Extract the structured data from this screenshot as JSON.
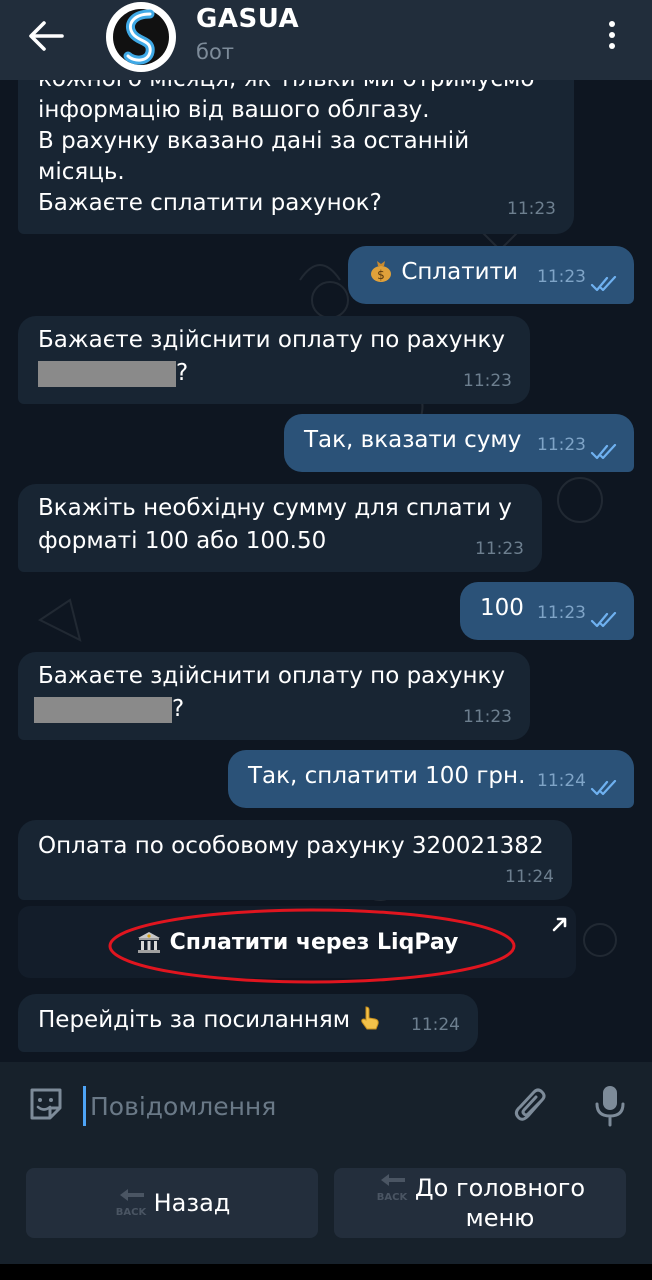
{
  "header": {
    "title": "GASUA",
    "subtitle": "бот"
  },
  "messages": [
    {
      "dir": "in",
      "lines": [
        "кожного місяця, як тільки ми отримуємо",
        "інформацію від вашого облгазу.",
        "В рахунку вказано дані за останній",
        "місяць.",
        "Бажаєте сплатити рахунок?"
      ],
      "time": "11:23"
    },
    {
      "dir": "out",
      "text": "Сплатити",
      "emoji": "money-bag",
      "time": "11:23"
    },
    {
      "dir": "in",
      "lines": [
        "Бажаєте здійснити оплату по рахунку",
        "?"
      ],
      "time": "11:23",
      "redacted": true
    },
    {
      "dir": "out",
      "text": "Так, вказати суму",
      "time": "11:23"
    },
    {
      "dir": "in",
      "lines": [
        "Вкажіть необхідну сумму для сплати у",
        "форматі 100 або 100.50"
      ],
      "time": "11:23"
    },
    {
      "dir": "out",
      "text": "100",
      "time": "11:23"
    },
    {
      "dir": "in",
      "lines": [
        "Бажаєте здійснити оплату по рахунку",
        "?"
      ],
      "time": "11:23",
      "redacted": true
    },
    {
      "dir": "out",
      "text": "Так, сплатити 100 грн.",
      "time": "11:24"
    },
    {
      "dir": "in",
      "lines": [
        "Оплата по особовому рахунку 320021382"
      ],
      "time": "11:24"
    },
    {
      "dir": "in",
      "lines": [
        "Перейдіть за посиланням"
      ],
      "emoji": "pointing-hand",
      "time": "11:24"
    }
  ],
  "inline_button": {
    "label": "Сплатити через LiqPay",
    "emoji": "bank"
  },
  "composer": {
    "placeholder": "Повідомлення"
  },
  "keyboard": {
    "buttons": [
      {
        "label": "Назад",
        "emoji": "back-arrow"
      },
      {
        "label_line1": "До головного",
        "label_line2": "меню",
        "emoji": "back-arrow"
      }
    ]
  },
  "colors": {
    "header_bg": "#212d3b",
    "chat_bg": "#0e1621",
    "incoming_bubble": "#182533",
    "outgoing_bubble": "#2b5278",
    "read_checks": "#6fb1f0",
    "annotation_ellipse": "#e0151f",
    "caret": "#4ea4f6"
  }
}
